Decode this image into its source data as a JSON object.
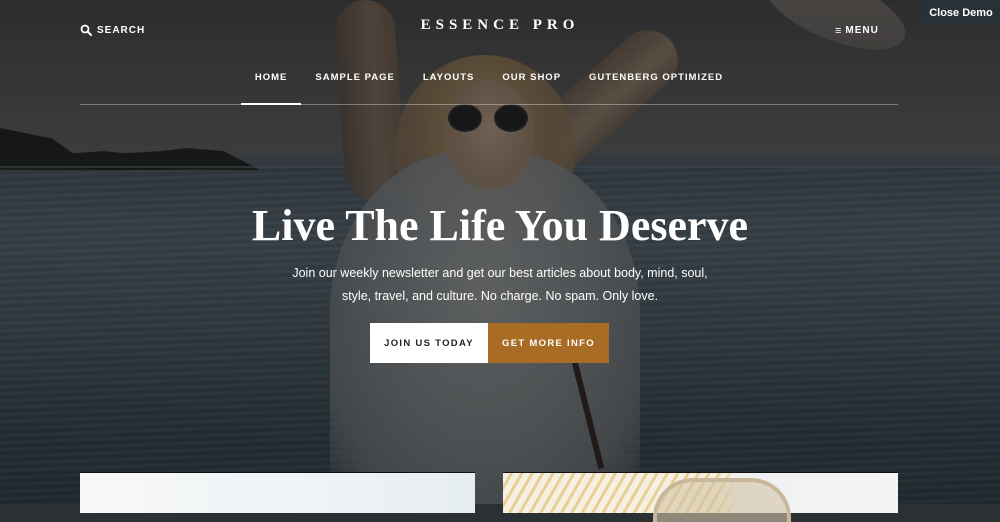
{
  "header": {
    "search_label": "SEARCH",
    "search_icon": "search-icon",
    "site_title": "ESSENCE PRO",
    "menu_label": "MENU",
    "menu_icon": "hamburger-icon",
    "close_demo_label": "Close Demo"
  },
  "nav": {
    "items": [
      {
        "label": "HOME",
        "active": true
      },
      {
        "label": "SAMPLE PAGE",
        "active": false
      },
      {
        "label": "LAYOUTS",
        "active": false
      },
      {
        "label": "OUR SHOP",
        "active": false
      },
      {
        "label": "GUTENBERG OPTIMIZED",
        "active": false
      }
    ]
  },
  "hero": {
    "title": "Live The Life You Deserve",
    "text_line1": "Join our weekly newsletter and get our best articles about body, mind, soul,",
    "text_line2": "style, travel, and culture. No charge. No spam. Only love.",
    "primary_button": "JOIN US TODAY",
    "secondary_button": "GET MORE INFO"
  },
  "colors": {
    "accent": "#a86c25",
    "close_demo_bg": "#2a3136",
    "text_light": "#ffffff"
  }
}
